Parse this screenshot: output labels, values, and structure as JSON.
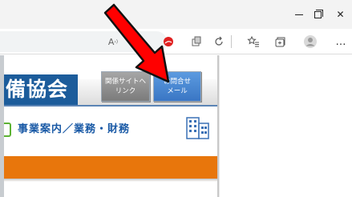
{
  "window": {
    "minimize_glyph": "–",
    "maximize_glyph": "",
    "close_glyph": "✕"
  },
  "toolbar": {
    "read_aloud_label": "A",
    "read_aloud_sup": "›)",
    "more_label": "…",
    "icons": [
      "read-aloud-icon",
      "zoom-icon",
      "extension-red-icon",
      "puzzle-icon",
      "refresh-collection-icon",
      "favorites-icon",
      "collections-icon",
      "profile-icon",
      "more-icon"
    ]
  },
  "site": {
    "org_name_fragment": "備協会",
    "related_sites_button": [
      "関係サイトへ",
      "リンク"
    ],
    "contact_button": [
      "お問合せ",
      "メール"
    ],
    "subnav_text": "事業案内／業務・財務"
  },
  "colors": {
    "accent_blue": "#1c5c9b",
    "button_gray": "#8e8e8e",
    "button_blue": "#4a88d4",
    "orange_bar": "#e8760c",
    "annotation_red": "#ff0000"
  }
}
